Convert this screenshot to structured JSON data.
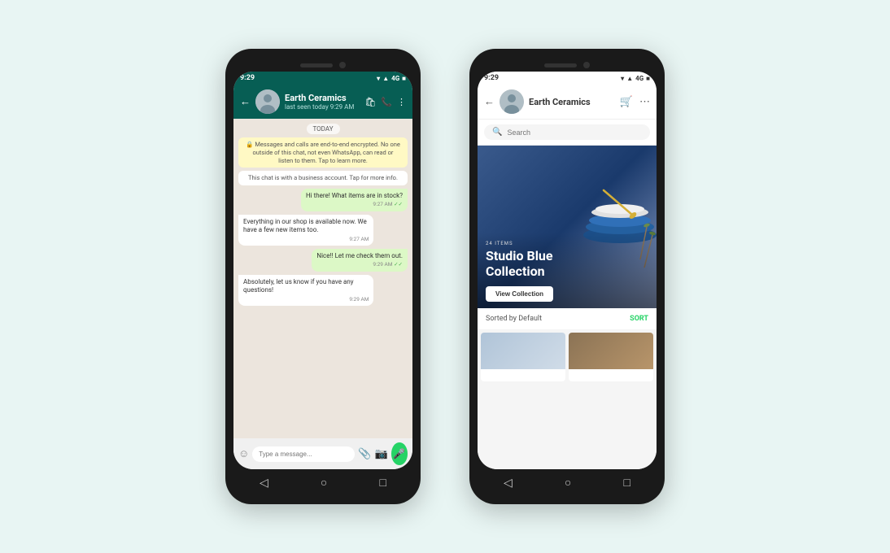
{
  "background_color": "#e8f5f3",
  "phone_left": {
    "status_bar": {
      "time": "9:29",
      "icons": "▾▲ 4G ■"
    },
    "header": {
      "back": "←",
      "name": "Earth Ceramics",
      "status": "last seen today 9:29 AM",
      "icon_bag": "🛍",
      "icon_phone": "📞",
      "icon_more": "⋮"
    },
    "chat": {
      "date_label": "TODAY",
      "system_msg1": "🔒 Messages and calls are end-to-end encrypted. No one outside of this chat, not even WhatsApp, can read or listen to them. Tap to learn more.",
      "system_msg2": "This chat is with a business account. Tap for more info.",
      "bubble_out1": {
        "text": "Hi there! What items are in stock?",
        "time": "9:27 AM",
        "ticks": "✓✓"
      },
      "bubble_in1": {
        "text": "Everything in our shop is available now. We have a few new items too.",
        "time": "9:27 AM"
      },
      "bubble_out2": {
        "text": "Nice!! Let me check them out.",
        "time": "9:29 AM",
        "ticks": "✓✓"
      },
      "bubble_in2": {
        "text": "Absolutely, let us know if you have any questions!",
        "time": "9:29 AM"
      }
    },
    "input_bar": {
      "placeholder": "Type a message...",
      "emoji": "☺",
      "attach": "📎",
      "camera": "📷",
      "mic": "🎤"
    },
    "nav": {
      "back": "◁",
      "home": "○",
      "square": "□"
    }
  },
  "phone_right": {
    "status_bar": {
      "time": "9:29",
      "icons": "▾▲ 4G ■"
    },
    "header": {
      "back": "←",
      "name": "Earth Ceramics",
      "icon_cart": "🛒",
      "icon_more": "⋯"
    },
    "search": {
      "placeholder": "Search",
      "icon": "🔍"
    },
    "hero": {
      "badge": "24 ITEMS",
      "title": "Studio Blue\nCollection",
      "btn_label": "View Collection"
    },
    "sort_bar": {
      "label": "Sorted by Default",
      "btn": "SORT"
    },
    "nav": {
      "back": "◁",
      "home": "○",
      "square": "□"
    }
  }
}
